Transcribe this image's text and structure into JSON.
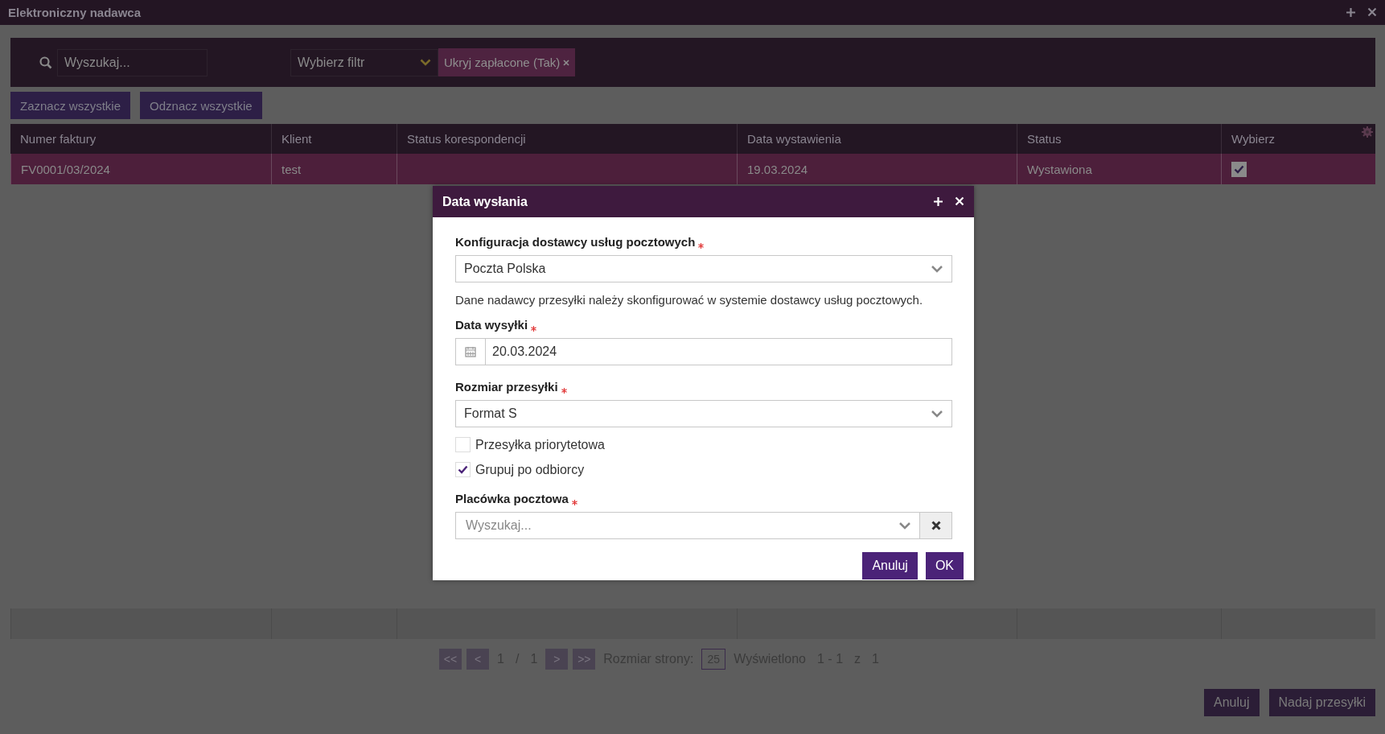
{
  "window": {
    "title": "Elektroniczny nadawca"
  },
  "toolbar": {
    "search": {
      "placeholder": "Wyszukaj..."
    },
    "filter": {
      "placeholder": "Wybierz filtr"
    },
    "chips": [
      {
        "label": "Ukryj zapłacone (Tak)"
      }
    ]
  },
  "actions": [
    "Zaznacz wszystkie",
    "Odznacz wszystkie"
  ],
  "table": {
    "columns": [
      "Numer faktury",
      "Klient",
      "Status korespondencji",
      "Data wystawienia",
      "Status",
      "Wybierz"
    ],
    "rows": [
      {
        "cells": [
          "FV0001/03/2024",
          "test",
          "",
          "19.03.2024",
          "Wystawiona"
        ],
        "selected": true,
        "checked": true
      }
    ]
  },
  "pagination": {
    "buttons": [
      "<<",
      "<",
      ">",
      ">>"
    ],
    "page": "1",
    "separator": "/",
    "pages": "1",
    "size_label": "Rozmiar strony:",
    "size": "25",
    "shown_label": "Wyświetlono",
    "range": "1 - 1",
    "of": "z",
    "total": "1"
  },
  "footer_buttons": [
    "Anuluj",
    "Nadaj przesyłki"
  ],
  "dialog": {
    "title": "Data wysłania",
    "fields": [
      {
        "kind": "select",
        "label": "Konfiguracja dostawcy usług pocztowych",
        "required": true,
        "value": "Poczta Polska"
      },
      {
        "kind": "note",
        "text": "Dane nadawcy przesyłki należy skonfigurować w systemie dostawcy usług pocztowych."
      },
      {
        "kind": "date",
        "label": "Data wysyłki",
        "required": true,
        "value": "20.03.2024"
      },
      {
        "kind": "select",
        "label": "Rozmiar przesyłki",
        "required": true,
        "value": "Format S"
      },
      {
        "kind": "checkbox",
        "label": "Przesyłka priorytetowa",
        "checked": false
      },
      {
        "kind": "checkbox",
        "label": "Grupuj po odbiorcy",
        "checked": true
      },
      {
        "kind": "search",
        "label": "Placówka pocztowa",
        "required": true,
        "placeholder": "Wyszukaj..."
      }
    ],
    "buttons": [
      "Anuluj",
      "OK"
    ]
  }
}
